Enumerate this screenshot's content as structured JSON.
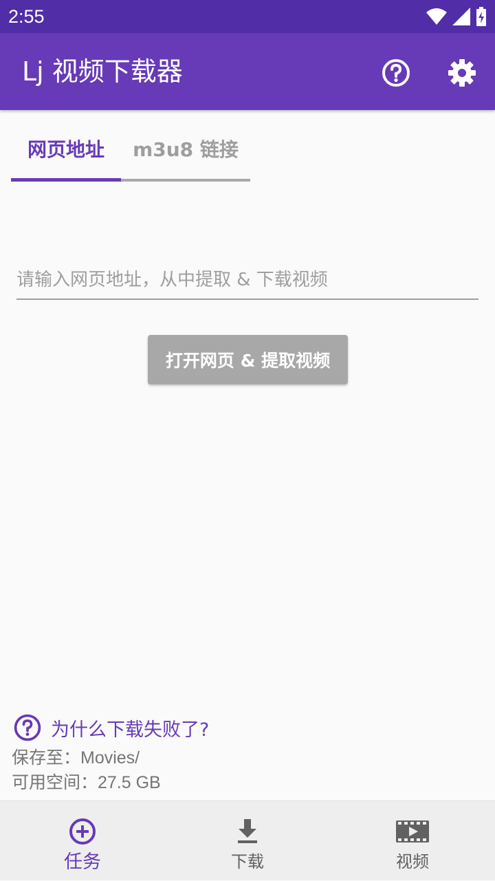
{
  "status_bar": {
    "time": "2:55",
    "icons": [
      "wifi-icon",
      "signal-icon",
      "battery-charging-icon"
    ]
  },
  "app_bar": {
    "title": "Lj 视频下载器",
    "actions": [
      "help-icon",
      "settings-icon"
    ],
    "color": "#673ab7"
  },
  "tabs": [
    {
      "label": "网页地址",
      "selected": true
    },
    {
      "label": "m3u8 链接",
      "selected": false
    }
  ],
  "url_input": {
    "value": "",
    "placeholder": "请输入网页地址，从中提取 & 下载视频"
  },
  "open_button": {
    "label": "打开网页 & 提取视频",
    "enabled": false
  },
  "help_link": {
    "label": "为什么下载失败了?"
  },
  "storage": {
    "save_to": "保存至：Movies/",
    "free_space": "可用空间：27.5 GB"
  },
  "bottom_nav": [
    {
      "label": "任务",
      "icon": "add-circle-icon",
      "selected": true
    },
    {
      "label": "下载",
      "icon": "download-icon",
      "selected": false
    },
    {
      "label": "视频",
      "icon": "video-icon",
      "selected": false
    }
  ],
  "colors": {
    "primary": "#673ab7",
    "primary_dark": "#512da8",
    "disabled": "#a8a8a8"
  }
}
